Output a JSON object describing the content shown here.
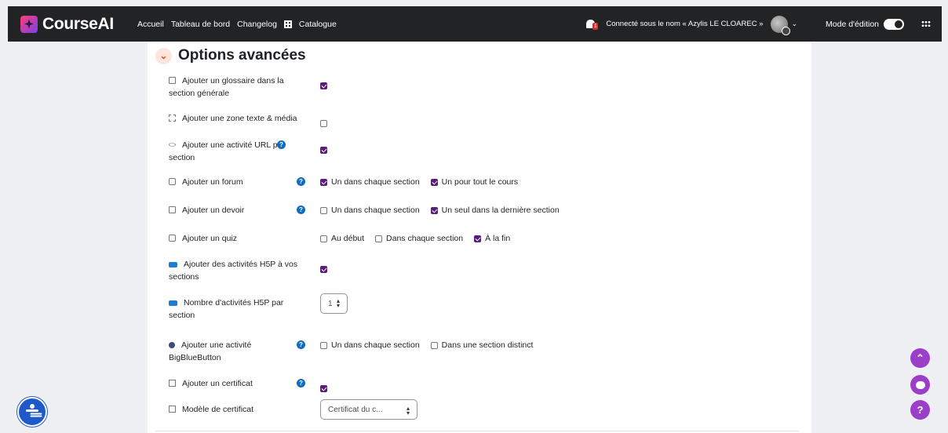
{
  "navbar": {
    "brand": "CourseAI",
    "links": [
      "Accueil",
      "Tableau de bord",
      "Changelog",
      "Catalogue"
    ],
    "notification_count": "1",
    "user_text": "Connecté sous le nom « Azylis LE CLOAREC »",
    "edit_mode_label": "Mode d'édition",
    "edit_mode_on": true
  },
  "section": {
    "title": "Options avancées",
    "collapse_icon": "chevron-down-icon"
  },
  "rows": [
    {
      "label": "Ajouter un glossaire dans la section générale",
      "icon": "glossary-icon",
      "help": false,
      "options": [
        {
          "label": "",
          "checked": true
        }
      ]
    },
    {
      "label": "Ajouter une zone texte & média",
      "icon": "text-media-icon",
      "help": false,
      "options": [
        {
          "label": "",
          "checked": false
        }
      ]
    },
    {
      "label": "Ajouter une activité URL par section",
      "icon": "url-icon",
      "help": true,
      "options": [
        {
          "label": "",
          "checked": true
        }
      ]
    },
    {
      "label": "Ajouter un forum",
      "icon": "forum-icon",
      "help": true,
      "options": [
        {
          "label": "Un dans chaque section",
          "checked": true
        },
        {
          "label": "Un pour tout le cours",
          "checked": true
        }
      ]
    },
    {
      "label": "Ajouter un devoir",
      "icon": "assignment-icon",
      "help": true,
      "options": [
        {
          "label": "Un dans chaque section",
          "checked": false
        },
        {
          "label": "Un seul dans la dernière section",
          "checked": true
        }
      ]
    },
    {
      "label": "Ajouter un quiz",
      "icon": "quiz-icon",
      "help": false,
      "options": [
        {
          "label": "Au début",
          "checked": false
        },
        {
          "label": "Dans chaque section",
          "checked": false
        },
        {
          "label": "À la fin",
          "checked": true
        }
      ]
    },
    {
      "label": "Ajouter des activités H5P à vos sections",
      "icon": "h5p-icon",
      "help": false,
      "options": [
        {
          "label": "",
          "checked": true
        }
      ]
    },
    {
      "label": "Nombre d'activités H5P par section",
      "icon": "h5p-icon",
      "help": false,
      "select_value": "1"
    },
    {
      "label": "Ajouter une activité BigBlueButton",
      "icon": "bigbluebutton-icon",
      "help": true,
      "options": [
        {
          "label": "Un dans chaque section",
          "checked": false
        },
        {
          "label": "Dans une section distinct",
          "checked": false
        }
      ]
    },
    {
      "label": "Ajouter un certificat",
      "icon": "certificate-icon",
      "help": true,
      "options": [
        {
          "label": "",
          "checked": true
        }
      ]
    },
    {
      "label": "Modèle de certificat",
      "icon": "certificate-icon",
      "help": false,
      "select_value": "Certificat du c..."
    }
  ],
  "floating": {
    "scroll_top_icon": "chevron-up-icon",
    "chat_icon": "chat-icon",
    "help_icon": "question-icon",
    "help_text": "?",
    "accessibility_icon": "accessibility-icon"
  },
  "colors": {
    "navbar_bg": "#222325",
    "checkbox_checked": "#5b1d7a",
    "help_blue": "#0f6cbf",
    "fab_purple": "#9b3ec8",
    "accent_orange": "#e0532a"
  }
}
